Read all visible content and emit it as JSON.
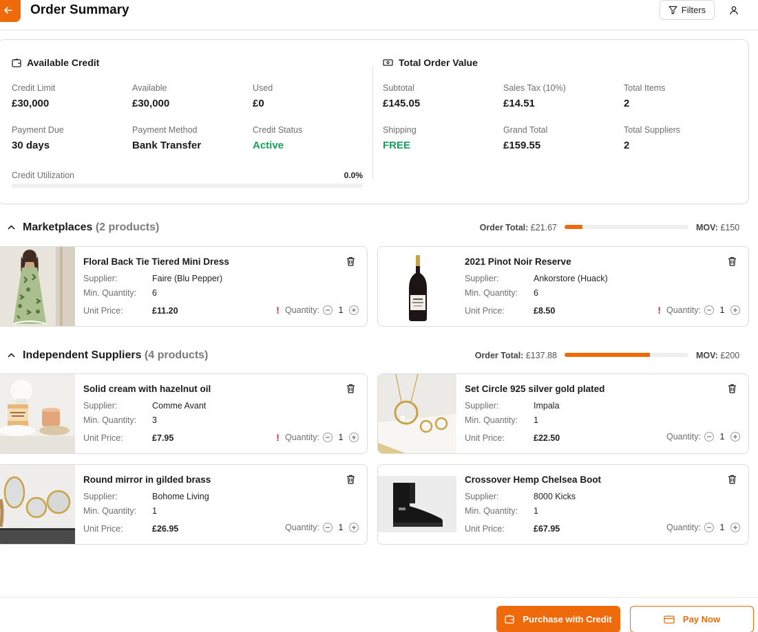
{
  "header": {
    "title": "Order Summary",
    "filters_label": "Filters"
  },
  "credit": {
    "title": "Available Credit",
    "fields": [
      {
        "label": "Credit Limit",
        "value": "£30,000"
      },
      {
        "label": "Available",
        "value": "£30,000"
      },
      {
        "label": "Used",
        "value": "£0"
      },
      {
        "label": "Payment Due",
        "value": "30 days"
      },
      {
        "label": "Payment Method",
        "value": "Bank Transfer"
      },
      {
        "label": "Credit Status",
        "value": "Active"
      }
    ],
    "utilization_label": "Credit Utilization",
    "utilization_value": "0.0%",
    "utilization_fraction": 0.0
  },
  "order_value": {
    "title": "Total Order Value",
    "fields": [
      {
        "label": "Subtotal",
        "value": "£145.05"
      },
      {
        "label": "Sales Tax (10%)",
        "value": "£14.51"
      },
      {
        "label": "Total Items",
        "value": "2"
      },
      {
        "label": "Shipping",
        "value": "FREE"
      },
      {
        "label": "Grand Total",
        "value": "£159.55"
      },
      {
        "label": "Total Suppliers",
        "value": "2"
      }
    ]
  },
  "groups": [
    {
      "title": "Marketplaces",
      "count": "(2 products)",
      "order_total_label": "Order Total:",
      "order_total_value": "£21.67",
      "mov_label": "MOV:",
      "mov_value": "£150",
      "progress_fraction": 0.144,
      "products": [
        {
          "name": "Floral Back Tie Tiered Mini Dress",
          "supplier": "Faire (Blu Pepper)",
          "min_qty": "6",
          "unit_price": "£11.20",
          "quantity": "1",
          "warning": "!"
        },
        {
          "name": "2021 Pinot Noir Reserve",
          "supplier": "Ankorstore (Huack)",
          "min_qty": "6",
          "unit_price": "£8.50",
          "quantity": "1",
          "warning": "!"
        }
      ]
    },
    {
      "title": "Independent Suppliers",
      "count": "(4 products)",
      "order_total_label": "Order Total:",
      "order_total_value": "£137.88",
      "mov_label": "MOV:",
      "mov_value": "£200",
      "progress_fraction": 0.689,
      "products": [
        {
          "name": "Solid cream with hazelnut oil",
          "supplier": "Comme Avant",
          "min_qty": "3",
          "unit_price": "£7.95",
          "quantity": "1",
          "warning": "!"
        },
        {
          "name": "Set Circle 925 silver gold plated",
          "supplier": "Impala",
          "min_qty": "1",
          "unit_price": "£22.50",
          "quantity": "1",
          "warning": ""
        },
        {
          "name": "Round mirror in gilded brass",
          "supplier": "Bohome Living",
          "min_qty": "1",
          "unit_price": "£26.95",
          "quantity": "1",
          "warning": ""
        },
        {
          "name": "Crossover Hemp Chelsea Boot",
          "supplier": "8000 Kicks",
          "min_qty": "1",
          "unit_price": "£67.95",
          "quantity": "1",
          "warning": ""
        }
      ]
    }
  ],
  "labels": {
    "supplier": "Supplier:",
    "min_qty": "Min. Quantity:",
    "unit_price": "Unit Price:",
    "quantity": "Quantity:"
  },
  "footer": {
    "purchase_credit": "Purchase with Credit",
    "pay_now": "Pay Now"
  },
  "colors": {
    "accent": "#ee6a0b",
    "success": "#16a05a",
    "warning": "#e02424"
  },
  "icons": {
    "back": "arrow-left-icon",
    "filters": "filter-icon",
    "user": "user-icon",
    "credit": "wallet-icon",
    "order_value": "banknote-icon",
    "collapse": "chevron-up-icon",
    "delete": "trash-icon",
    "decrease": "minus-circle-icon",
    "increase": "plus-circle-icon",
    "purchase_credit": "wallet-icon",
    "pay_now": "credit-card-icon"
  }
}
